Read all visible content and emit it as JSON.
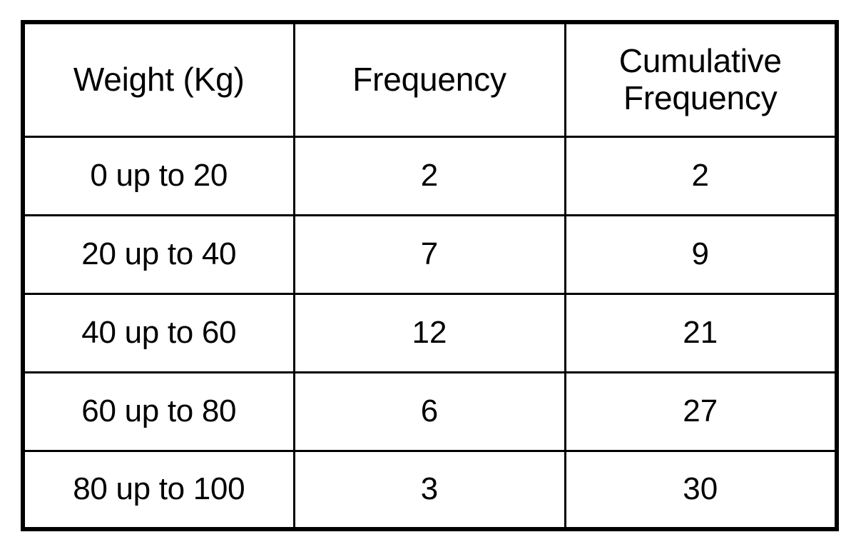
{
  "table": {
    "columns": [
      {
        "key": "weight",
        "label": "Weight (Kg)"
      },
      {
        "key": "frequency",
        "label": "Frequency"
      },
      {
        "key": "cumulative",
        "label": "Cumulative\nFrequency"
      }
    ],
    "rows": [
      {
        "weight": "0 up to 20",
        "frequency": "2",
        "cumulative": "2"
      },
      {
        "weight": "20 up to 40",
        "frequency": "7",
        "cumulative": "9"
      },
      {
        "weight": "40 up to 60",
        "frequency": "12",
        "cumulative": "21"
      },
      {
        "weight": "60 up to 80",
        "frequency": "6",
        "cumulative": "27"
      },
      {
        "weight": "80 up to 100",
        "frequency": "3",
        "cumulative": "30"
      }
    ]
  },
  "chart_data": {
    "type": "table",
    "title": "",
    "columns": [
      "Weight (Kg)",
      "Frequency",
      "Cumulative Frequency"
    ],
    "categories": [
      "0 up to 20",
      "20 up to 40",
      "40 up to 60",
      "60 up to 80",
      "80 up to 100"
    ],
    "series": [
      {
        "name": "Frequency",
        "values": [
          2,
          7,
          12,
          6,
          3
        ]
      },
      {
        "name": "Cumulative Frequency",
        "values": [
          2,
          9,
          21,
          27,
          30
        ]
      }
    ],
    "xlabel": "Weight (Kg)",
    "ylabel": "",
    "total_frequency": 30,
    "class_width": 20,
    "grid": true,
    "legend": "none"
  },
  "style": {
    "border_color": "#000000",
    "text_color": "#000000",
    "background": "#ffffff"
  }
}
